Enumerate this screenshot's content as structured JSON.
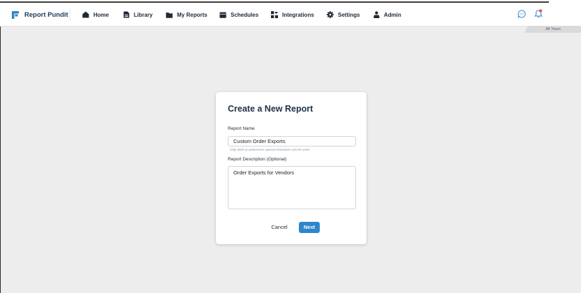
{
  "brand": {
    "name": "Report Pundit"
  },
  "nav": {
    "items": [
      {
        "label": "Home",
        "icon": "home-icon"
      },
      {
        "label": "Library",
        "icon": "document-icon"
      },
      {
        "label": "My Reports",
        "icon": "folder-icon"
      },
      {
        "label": "Schedules",
        "icon": "calendar-icon"
      },
      {
        "label": "Integrations",
        "icon": "grid-icon"
      },
      {
        "label": "Settings",
        "icon": "gear-icon"
      },
      {
        "label": "Admin",
        "icon": "user-icon"
      }
    ],
    "right_icons": [
      "chat-icon",
      "bell-icon"
    ]
  },
  "tag": {
    "text": "All Yours"
  },
  "dialog": {
    "title": "Create a New Report",
    "name_label": "Report Name",
    "name_value": "Custom Order Exports",
    "name_hint": "Only dash & underscore special characters can be used",
    "description_label": "Report Description (Optional)",
    "description_value": "Order Exports for Vendors",
    "cancel_label": "Cancel",
    "next_label": "Next"
  },
  "colors": {
    "accent": "#2f86c9",
    "brand": "#1f3b57",
    "background": "#ededee",
    "notification": "#e5484d"
  }
}
